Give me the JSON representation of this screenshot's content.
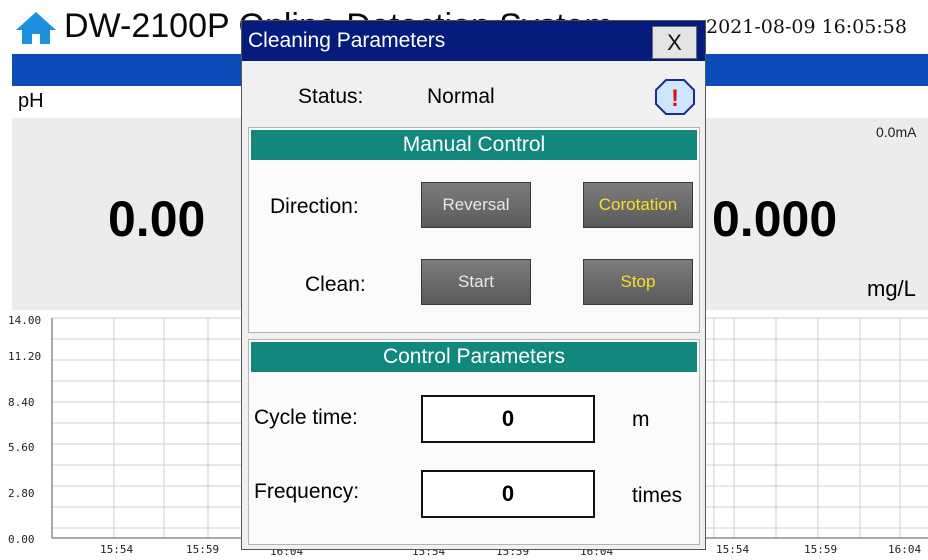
{
  "header": {
    "title": "DW-2100P Online Detection System",
    "datetime": "2021-08-09 16:05:58",
    "home_icon": "home-icon",
    "brand_color": "#0b4cb8"
  },
  "measurements": {
    "ph_label": "pH",
    "ph_value": "0.00",
    "current_value": "0.0mA",
    "second_value": "0.000",
    "second_unit": "mg/L"
  },
  "chart_data": {
    "type": "line",
    "y_ticks": [
      "14.00",
      "11.20",
      "8.40",
      "5.60",
      "2.80",
      "0.00"
    ],
    "ylim": [
      0,
      14
    ],
    "x_ticks_left": [
      "15:54",
      "15:59",
      "16:04"
    ],
    "x_ticks_mid": [
      "15:54",
      "15:59",
      "16:04"
    ],
    "x_ticks_right": [
      "15:54",
      "15:59",
      "16:04"
    ],
    "grid": true,
    "series": []
  },
  "dialog": {
    "title": "Cleaning Parameters",
    "close_label": "X",
    "status_label": "Status:",
    "status_value": "Normal",
    "alarm_icon": "alarm-exclamation-icon",
    "alarm_mark": "!",
    "manual_control": {
      "header": "Manual Control",
      "direction_label": "Direction:",
      "reversal_label": "Reversal",
      "corotation_label": "Corotation",
      "clean_label": "Clean:",
      "start_label": "Start",
      "stop_label": "Stop"
    },
    "control_parameters": {
      "header": "Control Parameters",
      "cycle_time_label": "Cycle time:",
      "cycle_time_value": "0",
      "cycle_time_unit": "m",
      "frequency_label": "Frequency:",
      "frequency_value": "0",
      "frequency_unit": "times"
    },
    "colors": {
      "titlebar": "#061c7d",
      "section_header": "#12877e",
      "active_button_text": "#f5e12a"
    }
  }
}
